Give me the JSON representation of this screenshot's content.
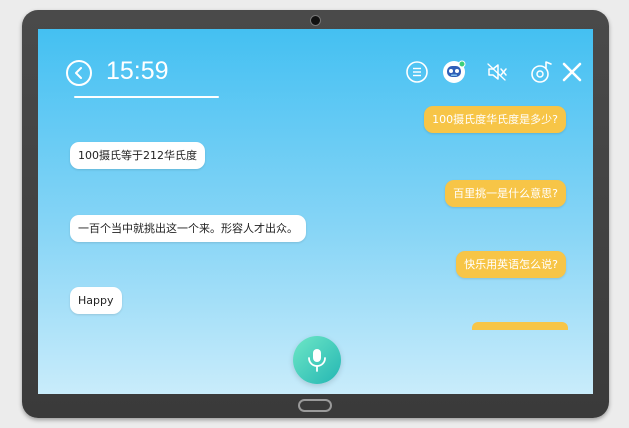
{
  "header": {
    "time": "15:59",
    "icons": [
      "back-icon",
      "list-icon",
      "robot-avatar-icon",
      "mute-icon",
      "music-icon",
      "close-icon"
    ]
  },
  "messages": [
    {
      "from": "user",
      "text": "100摄氏度华氏度是多少?"
    },
    {
      "from": "bot",
      "text": "100摄氏等于212华氏度"
    },
    {
      "from": "user",
      "text": "百里挑一是什么意思?"
    },
    {
      "from": "bot",
      "text": "一百个当中就挑出这一个来。形容人才出众。"
    },
    {
      "from": "user",
      "text": "快乐用英语怎么说?"
    },
    {
      "from": "bot",
      "text": "Happy"
    }
  ],
  "colors": {
    "user_bubble": "#f7c547",
    "bot_bubble": "#ffffff",
    "screen_top": "#44c0f2",
    "mic_accent": "#24b6b3"
  }
}
